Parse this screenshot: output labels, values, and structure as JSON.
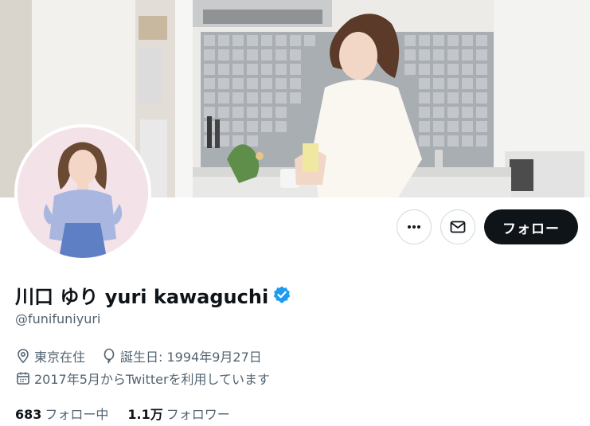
{
  "profile": {
    "display_name": "川口 ゆり yuri kawaguchi",
    "handle": "@funifuniyuri",
    "location": "東京在住",
    "birthday": "誕生日: 1994年9月27日",
    "joined": "2017年5月からTwitterを利用しています",
    "following_count": "683",
    "following_label": "フォロー中",
    "followers_count": "1.1万",
    "followers_label": "フォロワー"
  },
  "actions": {
    "follow_label": "フォロー"
  },
  "icons": {
    "more": "more-icon",
    "message": "mail-icon",
    "verified": "verified-badge-icon",
    "location": "location-pin-icon",
    "birthday": "balloon-icon",
    "joined": "calendar-icon"
  },
  "colors": {
    "verified_blue": "#1d9bf0",
    "follow_button_bg": "#0f1419",
    "secondary_text": "#536471"
  }
}
